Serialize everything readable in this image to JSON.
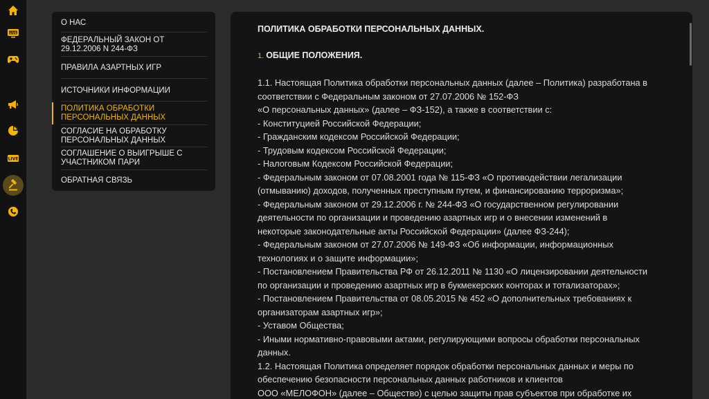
{
  "sidebar": {
    "icons": [
      {
        "name": "home-icon",
        "color": "#f5b400"
      },
      {
        "name": "live-tv-icon",
        "color": "#f5b400"
      },
      {
        "name": "gamepad-icon",
        "color": "#f5b400"
      },
      {
        "name": "megaphone-icon",
        "color": "#f5b400"
      },
      {
        "name": "pie-chart-icon",
        "color": "#f5b400"
      },
      {
        "name": "live-badge-icon",
        "color": "#f5b400",
        "text": "LIVE"
      },
      {
        "name": "gavel-icon",
        "color": "#f5b400",
        "active": true
      },
      {
        "name": "support-icon",
        "color": "#f5b400"
      }
    ]
  },
  "menu": {
    "items": [
      {
        "label": "О НАС"
      },
      {
        "label": "ФЕДЕРАЛЬНЫЙ ЗАКОН ОТ 29.12.2006 N 244-ФЗ"
      },
      {
        "label": "ПРАВИЛА АЗАРТНЫХ ИГР"
      },
      {
        "label": "ИСТОЧНИКИ ИНФОРМАЦИИ"
      },
      {
        "label": "ПОЛИТИКА ОБРАБОТКИ ПЕРСОНАЛЬНЫХ ДАННЫХ",
        "active": true
      },
      {
        "label": "СОГЛАСИЕ НА ОБРАБОТКУ ПЕРСОНАЛЬНЫХ ДАННЫХ"
      },
      {
        "label": "СОГЛАШЕНИЕ О ВЫИГРЫШЕ С УЧАСТНИКОМ ПАРИ"
      },
      {
        "label": "ОБРАТНАЯ СВЯЗЬ"
      }
    ]
  },
  "document": {
    "title": "ПОЛИТИКА ОБРАБОТКИ ПЕРСОНАЛЬНЫХ ДАННЫХ.",
    "section_number": "1.",
    "section_title": "ОБЩИЕ ПОЛОЖЕНИЯ.",
    "lines": [
      "1.1. Настоящая Политика обработки персональных данных (далее – Политика) разработана в",
      "соответствии с Федеральным законом от 27.07.2006 № 152-ФЗ",
      "«О персональных данных» (далее – ФЗ-152), а также в соответствии с:",
      "- Конституцией Российской Федерации;",
      "- Гражданским кодексом Российской Федерации;",
      "- Трудовым кодексом Российской Федерации;",
      "- Налоговым Кодексом Российской Федерации;",
      "- Федеральным законом от 07.08.2001 года № 115-ФЗ «О противодействии легализации",
      "(отмыванию) доходов, полученных преступным путем, и финансированию терроризма»;",
      "- Федеральным законом от 29.12.2006 г. № 244-ФЗ «О государственном регулировании",
      "деятельности по организации и проведению азартных игр и о внесении изменений в",
      "некоторые законодательные акты Российской Федерации» (далее ФЗ-244);",
      "- Федеральным законом от 27.07.2006 № 149-ФЗ «Об информации, информационных",
      "технологиях и о защите информации»;",
      "- Постановлением Правительства РФ от 26.12.2011 № 1130 «О лицензировании деятельности",
      "по организации и проведению азартных игр в букмекерских конторах и тотализаторах»;",
      "- Постановлением Правительства от 08.05.2015 № 452 «О дополнительных требованиях к",
      "организаторам азартных игр»;",
      "- Уставом Общества;",
      "- Иными нормативно-правовыми актами, регулирующими вопросы обработки персональных",
      "данных.",
      "1.2. Настоящая Политика определяет порядок обработки персональных данных и меры по",
      "обеспечению безопасности персональных данных работников и клиентов",
      "ООО «МЕЛОФОН» (далее – Общество) с целью защиты прав субъектов при обработке их"
    ]
  }
}
